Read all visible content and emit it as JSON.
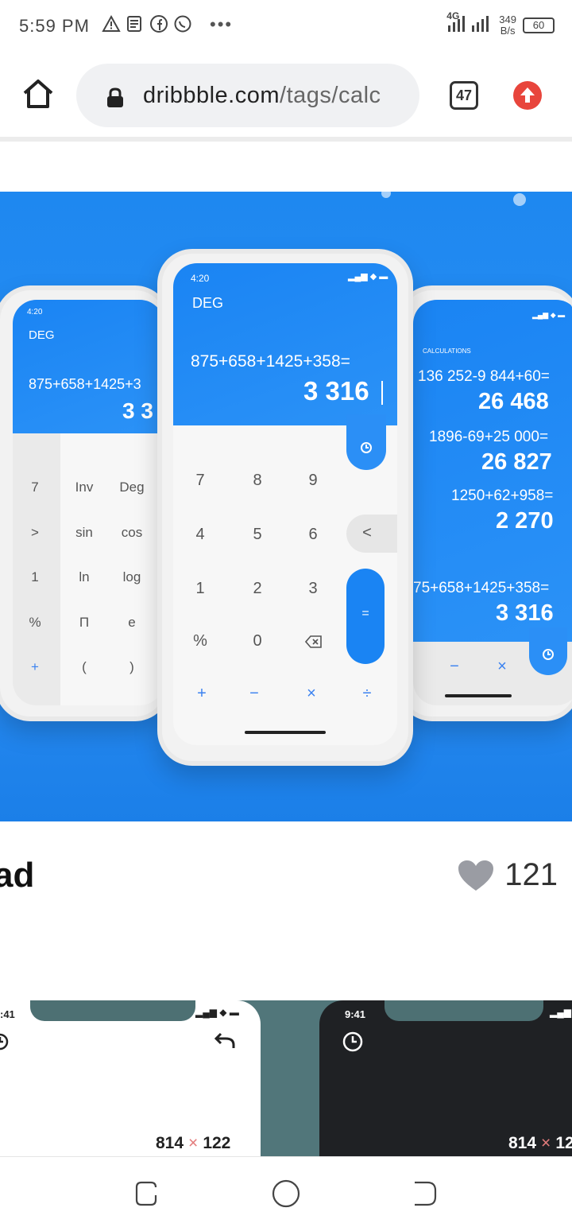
{
  "status_bar": {
    "time": "5:59 PM",
    "network_label": "4G",
    "speed_top": "349",
    "speed_bottom": "B/s",
    "battery": "60",
    "notification_icons": [
      "warning-icon",
      "news-icon",
      "facebook-icon",
      "whatsapp-icon"
    ],
    "more": "•••"
  },
  "browser": {
    "url_domain": "dribbble.com",
    "url_path": "/tags/calc",
    "tab_count": "47"
  },
  "shot": {
    "colors": {
      "bg": "#2288f2",
      "accent": "#1a84f3"
    },
    "center_phone": {
      "time": "4:20",
      "mode": "DEG",
      "expression": "875+658+1425+358=",
      "result": "3 316",
      "keys": [
        "7",
        "8",
        "9",
        "4",
        "5",
        "6",
        "1",
        "2",
        "3",
        "%",
        "0"
      ],
      "back": "<",
      "equals": "=",
      "ops": [
        "+",
        "−",
        "×",
        "÷"
      ]
    },
    "left_phone": {
      "time": "4:20",
      "mode": "DEG",
      "expression": "875+658+1425+3",
      "result": "3 3",
      "col1": [
        "7",
        ">",
        "1",
        "%",
        "+"
      ],
      "col2": [
        "Inv",
        "sin",
        "ln",
        "Π",
        "("
      ],
      "col3": [
        "Deg",
        "cos",
        "log",
        "e",
        ")"
      ]
    },
    "right_phone": {
      "header": "CALCULATIONS",
      "history": [
        {
          "expression": "136 252-9 844+60=",
          "result": "26 468"
        },
        {
          "expression": "1896-69+25 000=",
          "result": "26 827"
        },
        {
          "expression": "1250+62+958=",
          "result": "2 270"
        },
        {
          "expression": "75+658+1425+358=",
          "result": "3 316"
        }
      ],
      "ops": [
        "−",
        "×"
      ]
    }
  },
  "shot_title": "ad",
  "likes": "121",
  "previews": {
    "left": {
      "time": ":41",
      "a": "814",
      "op": "×",
      "b": "122"
    },
    "right": {
      "time": "9:41",
      "a": "814",
      "op": "×",
      "b": "12"
    }
  }
}
